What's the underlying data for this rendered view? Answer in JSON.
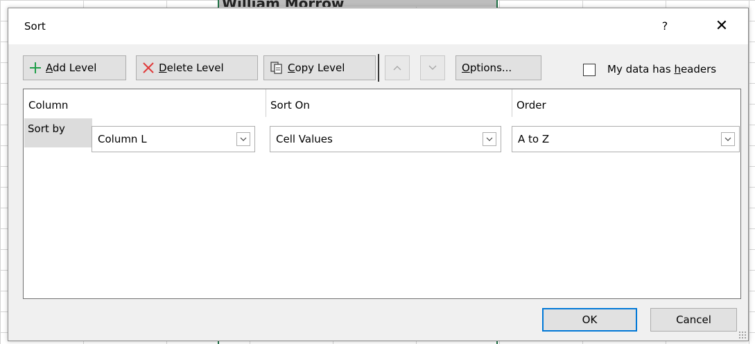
{
  "background": {
    "cell_text": "William Morrow",
    "grid_color": "#d4d4d4",
    "active_column_color": "#1e7145"
  },
  "dialog": {
    "title": "Sort",
    "help_glyph": "?",
    "close_glyph": "✕"
  },
  "toolbar": {
    "add_level": {
      "mnemonic": "A",
      "rest": "dd Level",
      "icon": "plus-icon",
      "icon_color": "#1e9e48"
    },
    "delete_level": {
      "mnemonic": "D",
      "rest": "elete Level",
      "icon": "x-icon",
      "icon_color": "#e03a3a"
    },
    "copy_level": {
      "mnemonic": "C",
      "rest": "opy Level",
      "icon": "copy-icon"
    },
    "move_up": {
      "icon": "chevron-up-icon"
    },
    "move_down": {
      "icon": "chevron-down-icon"
    },
    "options": {
      "mnemonic": "O",
      "rest": "ptions..."
    },
    "headers": {
      "label_pre": "My data has ",
      "mnemonic": "h",
      "label_post": "eaders",
      "checked": false
    }
  },
  "grid": {
    "headers": {
      "column": "Column",
      "sort_on": "Sort On",
      "order": "Order"
    },
    "rows": [
      {
        "label": "Sort by",
        "column": "Column L",
        "sort_on": "Cell Values",
        "order": "A to Z"
      }
    ]
  },
  "buttons": {
    "ok": "OK",
    "cancel": "Cancel",
    "default_border_color": "#0078d7"
  }
}
